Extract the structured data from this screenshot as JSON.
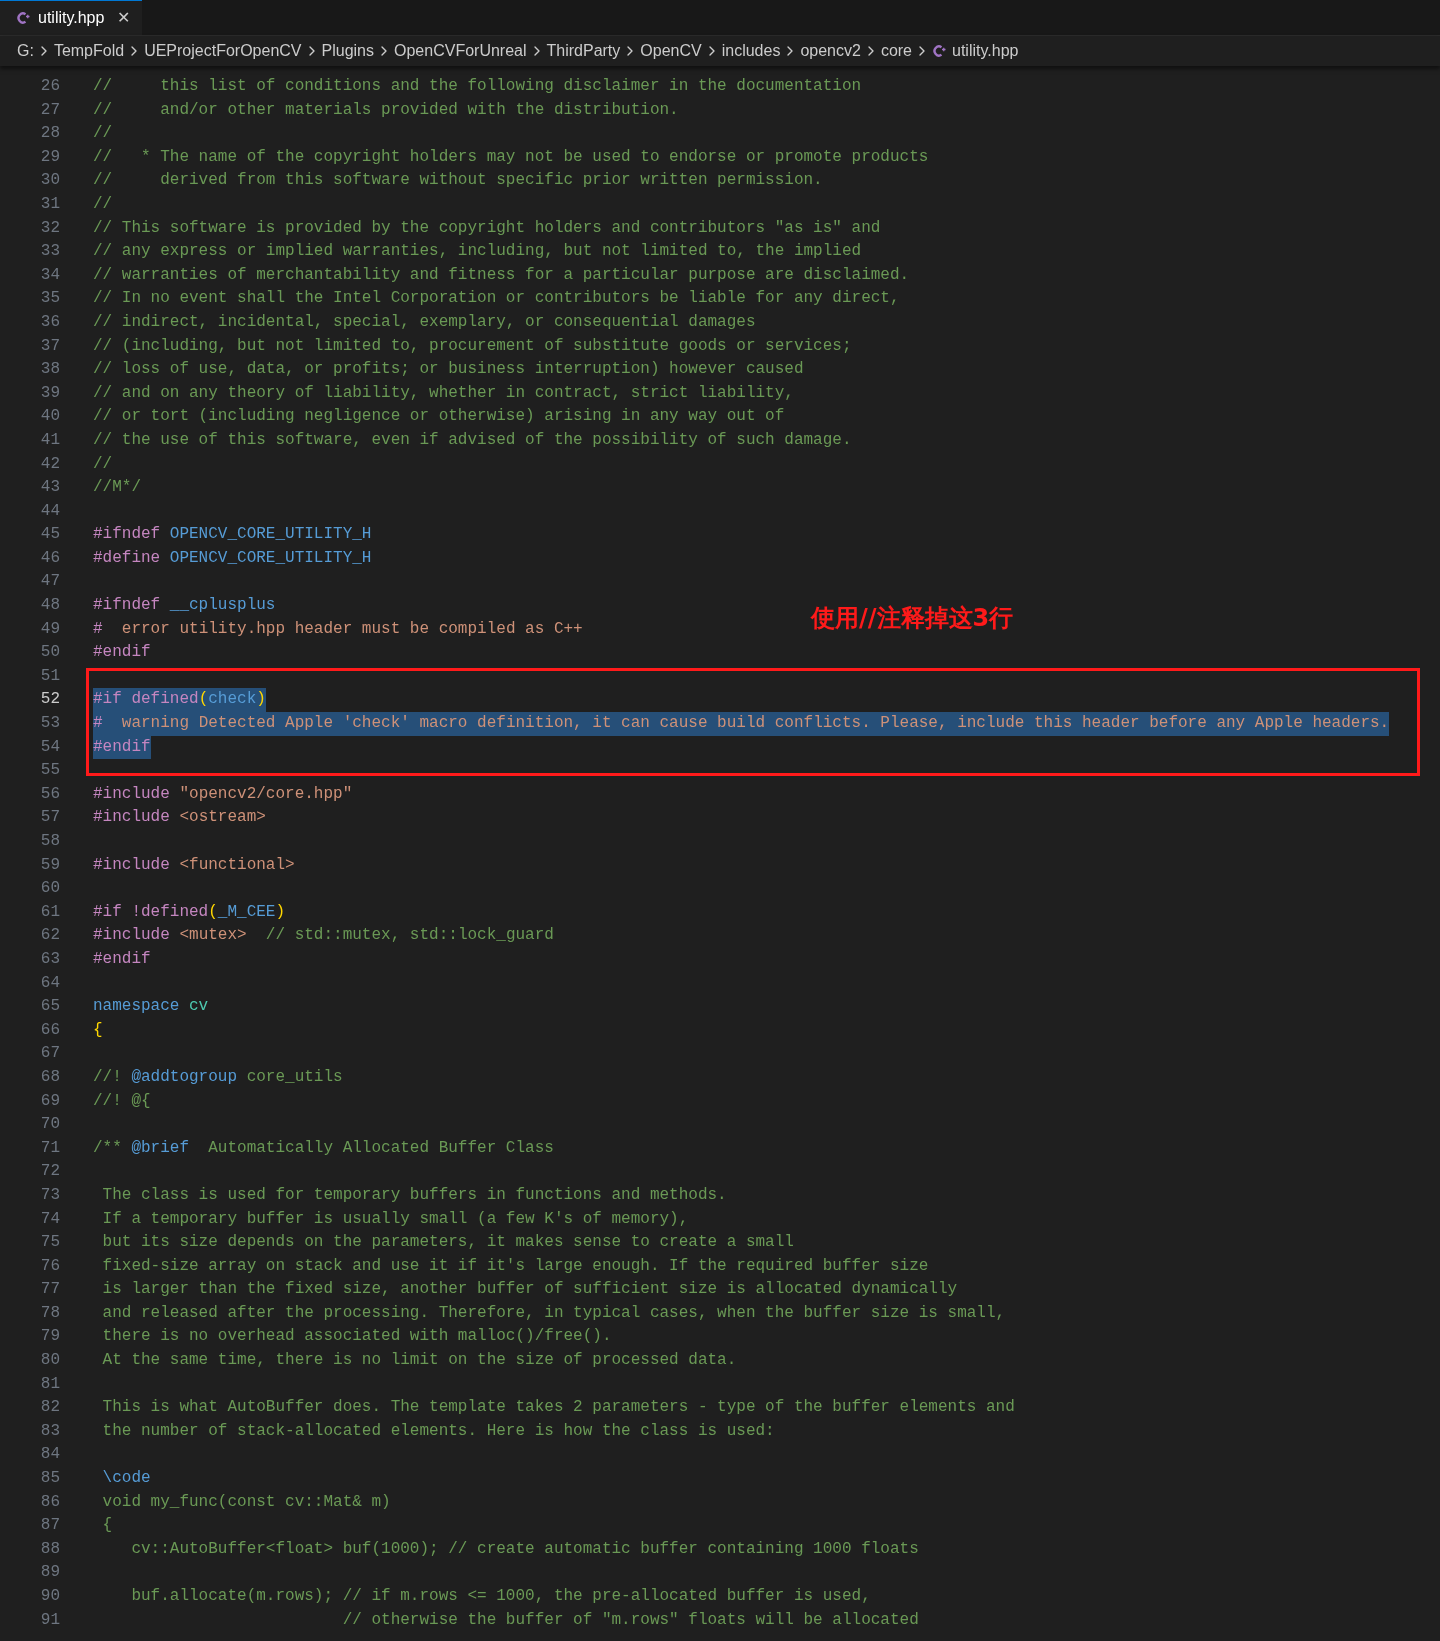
{
  "tab": {
    "label": "utility.hpp",
    "selected": true,
    "close": "✕"
  },
  "breadcrumb": [
    {
      "label": "G:"
    },
    {
      "label": "TempFold"
    },
    {
      "label": "UEProjectForOpenCV"
    },
    {
      "label": "Plugins"
    },
    {
      "label": "OpenCVForUnreal"
    },
    {
      "label": "ThirdParty"
    },
    {
      "label": "OpenCV"
    },
    {
      "label": "includes"
    },
    {
      "label": "opencv2"
    },
    {
      "label": "core"
    },
    {
      "label": "utility.hpp",
      "kind": "file"
    }
  ],
  "annotation": {
    "text": "使用//注释掉这3行"
  },
  "lines": [
    {
      "number": "26",
      "current": false,
      "selected": false,
      "boxed": false,
      "tokens": [
        {
          "kind": "comment",
          "text": "//     this list of conditions and the following disclaimer in the documentation"
        }
      ]
    },
    {
      "number": "27",
      "current": false,
      "selected": false,
      "boxed": false,
      "tokens": [
        {
          "kind": "comment",
          "text": "//     and/or other materials provided with the distribution."
        }
      ]
    },
    {
      "number": "28",
      "current": false,
      "selected": false,
      "boxed": false,
      "tokens": [
        {
          "kind": "comment",
          "text": "//"
        }
      ]
    },
    {
      "number": "29",
      "current": false,
      "selected": false,
      "boxed": false,
      "tokens": [
        {
          "kind": "comment",
          "text": "//   * The name of the copyright holders may not be used to endorse or promote products"
        }
      ]
    },
    {
      "number": "30",
      "current": false,
      "selected": false,
      "boxed": false,
      "tokens": [
        {
          "kind": "comment",
          "text": "//     derived from this software without specific prior written permission."
        }
      ]
    },
    {
      "number": "31",
      "current": false,
      "selected": false,
      "boxed": false,
      "tokens": [
        {
          "kind": "comment",
          "text": "//"
        }
      ]
    },
    {
      "number": "32",
      "current": false,
      "selected": false,
      "boxed": false,
      "tokens": [
        {
          "kind": "comment",
          "text": "// This software is provided by the copyright holders and contributors \"as is\" and"
        }
      ]
    },
    {
      "number": "33",
      "current": false,
      "selected": false,
      "boxed": false,
      "tokens": [
        {
          "kind": "comment",
          "text": "// any express or implied warranties, including, but not limited to, the implied"
        }
      ]
    },
    {
      "number": "34",
      "current": false,
      "selected": false,
      "boxed": false,
      "tokens": [
        {
          "kind": "comment",
          "text": "// warranties of merchantability and fitness for a particular purpose are disclaimed."
        }
      ]
    },
    {
      "number": "35",
      "current": false,
      "selected": false,
      "boxed": false,
      "tokens": [
        {
          "kind": "comment",
          "text": "// In no event shall the Intel Corporation or contributors be liable for any direct,"
        }
      ]
    },
    {
      "number": "36",
      "current": false,
      "selected": false,
      "boxed": false,
      "tokens": [
        {
          "kind": "comment",
          "text": "// indirect, incidental, special, exemplary, or consequential damages"
        }
      ]
    },
    {
      "number": "37",
      "current": false,
      "selected": false,
      "boxed": false,
      "tokens": [
        {
          "kind": "comment",
          "text": "// (including, but not limited to, procurement of substitute goods or services;"
        }
      ]
    },
    {
      "number": "38",
      "current": false,
      "selected": false,
      "boxed": false,
      "tokens": [
        {
          "kind": "comment",
          "text": "// loss of use, data, or profits; or business interruption) however caused"
        }
      ]
    },
    {
      "number": "39",
      "current": false,
      "selected": false,
      "boxed": false,
      "tokens": [
        {
          "kind": "comment",
          "text": "// and on any theory of liability, whether in contract, strict liability,"
        }
      ]
    },
    {
      "number": "40",
      "current": false,
      "selected": false,
      "boxed": false,
      "tokens": [
        {
          "kind": "comment",
          "text": "// or tort (including negligence or otherwise) arising in any way out of"
        }
      ]
    },
    {
      "number": "41",
      "current": false,
      "selected": false,
      "boxed": false,
      "tokens": [
        {
          "kind": "comment",
          "text": "// the use of this software, even if advised of the possibility of such damage."
        }
      ]
    },
    {
      "number": "42",
      "current": false,
      "selected": false,
      "boxed": false,
      "tokens": [
        {
          "kind": "comment",
          "text": "//"
        }
      ]
    },
    {
      "number": "43",
      "current": false,
      "selected": false,
      "boxed": false,
      "tokens": [
        {
          "kind": "comment",
          "text": "//M*/"
        }
      ]
    },
    {
      "number": "44",
      "current": false,
      "selected": false,
      "boxed": false
    },
    {
      "number": "45",
      "current": false,
      "selected": false,
      "boxed": false,
      "tokens": [
        {
          "kind": "directive",
          "text": "#ifndef "
        },
        {
          "kind": "macro",
          "text": "OPENCV_CORE_UTILITY_H"
        }
      ]
    },
    {
      "number": "46",
      "current": false,
      "selected": false,
      "boxed": false,
      "tokens": [
        {
          "kind": "directive",
          "text": "#define "
        },
        {
          "kind": "macro",
          "text": "OPENCV_CORE_UTILITY_H"
        }
      ]
    },
    {
      "number": "47",
      "current": false,
      "selected": false,
      "boxed": false
    },
    {
      "number": "48",
      "current": false,
      "selected": false,
      "boxed": false,
      "tokens": [
        {
          "kind": "directive",
          "text": "#ifndef "
        },
        {
          "kind": "macro",
          "text": "__cplusplus"
        }
      ]
    },
    {
      "number": "49",
      "current": false,
      "selected": false,
      "boxed": false,
      "tokens": [
        {
          "kind": "directive",
          "text": "#  "
        },
        {
          "kind": "string",
          "text": "error utility.hpp header must be compiled as C++"
        }
      ]
    },
    {
      "number": "50",
      "current": false,
      "selected": false,
      "boxed": false,
      "tokens": [
        {
          "kind": "directive",
          "text": "#endif"
        }
      ]
    },
    {
      "number": "51",
      "current": false,
      "selected": false,
      "boxed": false
    },
    {
      "number": "52",
      "current": true,
      "selected": true,
      "boxed": true,
      "tokens": [
        {
          "kind": "directive",
          "text": "#if defined"
        },
        {
          "kind": "brace",
          "text": "("
        },
        {
          "kind": "macro",
          "text": "check"
        },
        {
          "kind": "brace",
          "text": ")"
        }
      ]
    },
    {
      "number": "53",
      "current": false,
      "selected": true,
      "boxed": true,
      "tokens": [
        {
          "kind": "directive",
          "text": "#  "
        },
        {
          "kind": "string",
          "text": "warning Detected Apple 'check' macro definition, it can cause build conflicts. Please, include this header before any Apple headers."
        }
      ]
    },
    {
      "number": "54",
      "current": false,
      "selected": true,
      "boxed": true,
      "tokens": [
        {
          "kind": "directive",
          "text": "#endif"
        }
      ]
    },
    {
      "number": "55",
      "current": false,
      "selected": false,
      "boxed": false
    },
    {
      "number": "56",
      "current": false,
      "selected": false,
      "boxed": false,
      "tokens": [
        {
          "kind": "directive",
          "text": "#include "
        },
        {
          "kind": "string",
          "text": "\"opencv2/core.hpp\""
        }
      ]
    },
    {
      "number": "57",
      "current": false,
      "selected": false,
      "boxed": false,
      "tokens": [
        {
          "kind": "directive",
          "text": "#include "
        },
        {
          "kind": "string",
          "text": "<ostream>"
        }
      ]
    },
    {
      "number": "58",
      "current": false,
      "selected": false,
      "boxed": false
    },
    {
      "number": "59",
      "current": false,
      "selected": false,
      "boxed": false,
      "tokens": [
        {
          "kind": "directive",
          "text": "#include "
        },
        {
          "kind": "string",
          "text": "<functional>"
        }
      ]
    },
    {
      "number": "60",
      "current": false,
      "selected": false,
      "boxed": false
    },
    {
      "number": "61",
      "current": false,
      "selected": false,
      "boxed": false,
      "tokens": [
        {
          "kind": "directive",
          "text": "#if !defined"
        },
        {
          "kind": "brace",
          "text": "("
        },
        {
          "kind": "macro",
          "text": "_M_CEE"
        },
        {
          "kind": "brace",
          "text": ")"
        }
      ]
    },
    {
      "number": "62",
      "current": false,
      "selected": false,
      "boxed": false,
      "tokens": [
        {
          "kind": "directive",
          "text": "#include "
        },
        {
          "kind": "string",
          "text": "<mutex>"
        },
        {
          "kind": "comment",
          "text": "  // std::mutex, std::lock_guard"
        }
      ]
    },
    {
      "number": "63",
      "current": false,
      "selected": false,
      "boxed": false,
      "tokens": [
        {
          "kind": "directive",
          "text": "#endif"
        }
      ]
    },
    {
      "number": "64",
      "current": false,
      "selected": false,
      "boxed": false
    },
    {
      "number": "65",
      "current": false,
      "selected": false,
      "boxed": false,
      "tokens": [
        {
          "kind": "keyword",
          "text": "namespace "
        },
        {
          "kind": "type",
          "text": "cv"
        }
      ]
    },
    {
      "number": "66",
      "current": false,
      "selected": false,
      "boxed": false,
      "tokens": [
        {
          "kind": "brace",
          "text": "{"
        }
      ]
    },
    {
      "number": "67",
      "current": false,
      "selected": false,
      "boxed": false
    },
    {
      "number": "68",
      "current": false,
      "selected": false,
      "boxed": false,
      "tokens": [
        {
          "kind": "comment",
          "text": "//! "
        },
        {
          "kind": "tag",
          "text": "@addtogroup"
        },
        {
          "kind": "comment",
          "text": " core_utils"
        }
      ]
    },
    {
      "number": "69",
      "current": false,
      "selected": false,
      "boxed": false,
      "tokens": [
        {
          "kind": "comment",
          "text": "//! @{"
        }
      ]
    },
    {
      "number": "70",
      "current": false,
      "selected": false,
      "boxed": false
    },
    {
      "number": "71",
      "current": false,
      "selected": false,
      "boxed": false,
      "tokens": [
        {
          "kind": "comment",
          "text": "/** "
        },
        {
          "kind": "tag",
          "text": "@brief"
        },
        {
          "kind": "comment",
          "text": "  Automatically Allocated Buffer Class"
        }
      ]
    },
    {
      "number": "72",
      "current": false,
      "selected": false,
      "boxed": false
    },
    {
      "number": "73",
      "current": false,
      "selected": false,
      "boxed": false,
      "tokens": [
        {
          "kind": "comment",
          "text": " The class is used for temporary buffers in functions and methods."
        }
      ]
    },
    {
      "number": "74",
      "current": false,
      "selected": false,
      "boxed": false,
      "tokens": [
        {
          "kind": "comment",
          "text": " If a temporary buffer is usually small (a few K's of memory),"
        }
      ]
    },
    {
      "number": "75",
      "current": false,
      "selected": false,
      "boxed": false,
      "tokens": [
        {
          "kind": "comment",
          "text": " but its size depends on the parameters, it makes sense to create a small"
        }
      ]
    },
    {
      "number": "76",
      "current": false,
      "selected": false,
      "boxed": false,
      "tokens": [
        {
          "kind": "comment",
          "text": " fixed-size array on stack and use it if it's large enough. If the required buffer size"
        }
      ]
    },
    {
      "number": "77",
      "current": false,
      "selected": false,
      "boxed": false,
      "tokens": [
        {
          "kind": "comment",
          "text": " is larger than the fixed size, another buffer of sufficient size is allocated dynamically"
        }
      ]
    },
    {
      "number": "78",
      "current": false,
      "selected": false,
      "boxed": false,
      "tokens": [
        {
          "kind": "comment",
          "text": " and released after the processing. Therefore, in typical cases, when the buffer size is small,"
        }
      ]
    },
    {
      "number": "79",
      "current": false,
      "selected": false,
      "boxed": false,
      "tokens": [
        {
          "kind": "comment",
          "text": " there is no overhead associated with malloc()/free()."
        }
      ]
    },
    {
      "number": "80",
      "current": false,
      "selected": false,
      "boxed": false,
      "tokens": [
        {
          "kind": "comment",
          "text": " At the same time, there is no limit on the size of processed data."
        }
      ]
    },
    {
      "number": "81",
      "current": false,
      "selected": false,
      "boxed": false
    },
    {
      "number": "82",
      "current": false,
      "selected": false,
      "boxed": false,
      "tokens": [
        {
          "kind": "comment",
          "text": " This is what AutoBuffer does. The template takes 2 parameters - type of the buffer elements and"
        }
      ]
    },
    {
      "number": "83",
      "current": false,
      "selected": false,
      "boxed": false,
      "tokens": [
        {
          "kind": "comment",
          "text": " the number of stack-allocated elements. Here is how the class is used:"
        }
      ]
    },
    {
      "number": "84",
      "current": false,
      "selected": false,
      "boxed": false
    },
    {
      "number": "85",
      "current": false,
      "selected": false,
      "boxed": false,
      "tokens": [
        {
          "kind": "tag",
          "text": " \\code"
        }
      ]
    },
    {
      "number": "86",
      "current": false,
      "selected": false,
      "boxed": false,
      "tokens": [
        {
          "kind": "comment",
          "text": " void my_func(const cv::Mat& m)"
        }
      ]
    },
    {
      "number": "87",
      "current": false,
      "selected": false,
      "boxed": false,
      "tokens": [
        {
          "kind": "comment",
          "text": " {"
        }
      ]
    },
    {
      "number": "88",
      "current": false,
      "selected": false,
      "boxed": false,
      "tokens": [
        {
          "kind": "comment",
          "text": "    cv::AutoBuffer<float> buf(1000); // create automatic buffer containing 1000 floats"
        }
      ]
    },
    {
      "number": "89",
      "current": false,
      "selected": false,
      "boxed": false
    },
    {
      "number": "90",
      "current": false,
      "selected": false,
      "boxed": false,
      "tokens": [
        {
          "kind": "comment",
          "text": "    buf.allocate(m.rows); // if m.rows <= 1000, the pre-allocated buffer is used,"
        }
      ]
    },
    {
      "number": "91",
      "current": false,
      "selected": false,
      "boxed": false,
      "tokens": [
        {
          "kind": "comment",
          "text": "                          // otherwise the buffer of \"m.rows\" floats will be allocated"
        }
      ]
    }
  ]
}
